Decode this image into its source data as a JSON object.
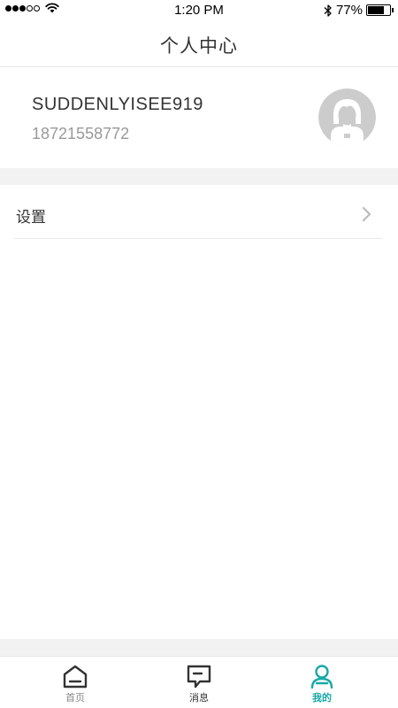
{
  "status_bar": {
    "time": "1:20 PM",
    "battery_percent": "77%",
    "battery_level": 0.77,
    "signal_bars_filled": 3,
    "signal_bars_total": 5
  },
  "nav": {
    "title": "个人中心"
  },
  "profile": {
    "username": "SUDDENLYISEE919",
    "phone": "18721558772",
    "avatar_icon": "default-avatar-icon"
  },
  "menu": {
    "settings_label": "设置",
    "settings_icon": "chevron-right-icon"
  },
  "tabs": [
    {
      "label": "首页",
      "icon": "home-icon",
      "active": false
    },
    {
      "label": "消息",
      "icon": "message-icon",
      "active": false
    },
    {
      "label": "我的",
      "icon": "user-icon",
      "active": true
    }
  ],
  "colors": {
    "accent": "#18a8a8",
    "background_band": "#f2f2f2",
    "text_primary": "#333333",
    "text_secondary": "#999999",
    "avatar_bg": "#cccccc"
  }
}
